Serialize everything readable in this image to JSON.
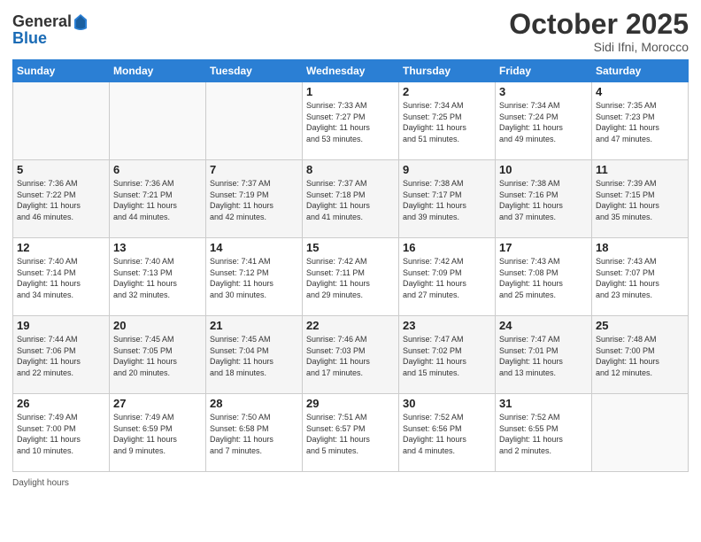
{
  "header": {
    "logo_general": "General",
    "logo_blue": "Blue",
    "month": "October 2025",
    "location": "Sidi Ifni, Morocco"
  },
  "weekdays": [
    "Sunday",
    "Monday",
    "Tuesday",
    "Wednesday",
    "Thursday",
    "Friday",
    "Saturday"
  ],
  "weeks": [
    [
      {
        "day": "",
        "info": ""
      },
      {
        "day": "",
        "info": ""
      },
      {
        "day": "",
        "info": ""
      },
      {
        "day": "1",
        "info": "Sunrise: 7:33 AM\nSunset: 7:27 PM\nDaylight: 11 hours\nand 53 minutes."
      },
      {
        "day": "2",
        "info": "Sunrise: 7:34 AM\nSunset: 7:25 PM\nDaylight: 11 hours\nand 51 minutes."
      },
      {
        "day": "3",
        "info": "Sunrise: 7:34 AM\nSunset: 7:24 PM\nDaylight: 11 hours\nand 49 minutes."
      },
      {
        "day": "4",
        "info": "Sunrise: 7:35 AM\nSunset: 7:23 PM\nDaylight: 11 hours\nand 47 minutes."
      }
    ],
    [
      {
        "day": "5",
        "info": "Sunrise: 7:36 AM\nSunset: 7:22 PM\nDaylight: 11 hours\nand 46 minutes."
      },
      {
        "day": "6",
        "info": "Sunrise: 7:36 AM\nSunset: 7:21 PM\nDaylight: 11 hours\nand 44 minutes."
      },
      {
        "day": "7",
        "info": "Sunrise: 7:37 AM\nSunset: 7:19 PM\nDaylight: 11 hours\nand 42 minutes."
      },
      {
        "day": "8",
        "info": "Sunrise: 7:37 AM\nSunset: 7:18 PM\nDaylight: 11 hours\nand 41 minutes."
      },
      {
        "day": "9",
        "info": "Sunrise: 7:38 AM\nSunset: 7:17 PM\nDaylight: 11 hours\nand 39 minutes."
      },
      {
        "day": "10",
        "info": "Sunrise: 7:38 AM\nSunset: 7:16 PM\nDaylight: 11 hours\nand 37 minutes."
      },
      {
        "day": "11",
        "info": "Sunrise: 7:39 AM\nSunset: 7:15 PM\nDaylight: 11 hours\nand 35 minutes."
      }
    ],
    [
      {
        "day": "12",
        "info": "Sunrise: 7:40 AM\nSunset: 7:14 PM\nDaylight: 11 hours\nand 34 minutes."
      },
      {
        "day": "13",
        "info": "Sunrise: 7:40 AM\nSunset: 7:13 PM\nDaylight: 11 hours\nand 32 minutes."
      },
      {
        "day": "14",
        "info": "Sunrise: 7:41 AM\nSunset: 7:12 PM\nDaylight: 11 hours\nand 30 minutes."
      },
      {
        "day": "15",
        "info": "Sunrise: 7:42 AM\nSunset: 7:11 PM\nDaylight: 11 hours\nand 29 minutes."
      },
      {
        "day": "16",
        "info": "Sunrise: 7:42 AM\nSunset: 7:09 PM\nDaylight: 11 hours\nand 27 minutes."
      },
      {
        "day": "17",
        "info": "Sunrise: 7:43 AM\nSunset: 7:08 PM\nDaylight: 11 hours\nand 25 minutes."
      },
      {
        "day": "18",
        "info": "Sunrise: 7:43 AM\nSunset: 7:07 PM\nDaylight: 11 hours\nand 23 minutes."
      }
    ],
    [
      {
        "day": "19",
        "info": "Sunrise: 7:44 AM\nSunset: 7:06 PM\nDaylight: 11 hours\nand 22 minutes."
      },
      {
        "day": "20",
        "info": "Sunrise: 7:45 AM\nSunset: 7:05 PM\nDaylight: 11 hours\nand 20 minutes."
      },
      {
        "day": "21",
        "info": "Sunrise: 7:45 AM\nSunset: 7:04 PM\nDaylight: 11 hours\nand 18 minutes."
      },
      {
        "day": "22",
        "info": "Sunrise: 7:46 AM\nSunset: 7:03 PM\nDaylight: 11 hours\nand 17 minutes."
      },
      {
        "day": "23",
        "info": "Sunrise: 7:47 AM\nSunset: 7:02 PM\nDaylight: 11 hours\nand 15 minutes."
      },
      {
        "day": "24",
        "info": "Sunrise: 7:47 AM\nSunset: 7:01 PM\nDaylight: 11 hours\nand 13 minutes."
      },
      {
        "day": "25",
        "info": "Sunrise: 7:48 AM\nSunset: 7:00 PM\nDaylight: 11 hours\nand 12 minutes."
      }
    ],
    [
      {
        "day": "26",
        "info": "Sunrise: 7:49 AM\nSunset: 7:00 PM\nDaylight: 11 hours\nand 10 minutes."
      },
      {
        "day": "27",
        "info": "Sunrise: 7:49 AM\nSunset: 6:59 PM\nDaylight: 11 hours\nand 9 minutes."
      },
      {
        "day": "28",
        "info": "Sunrise: 7:50 AM\nSunset: 6:58 PM\nDaylight: 11 hours\nand 7 minutes."
      },
      {
        "day": "29",
        "info": "Sunrise: 7:51 AM\nSunset: 6:57 PM\nDaylight: 11 hours\nand 5 minutes."
      },
      {
        "day": "30",
        "info": "Sunrise: 7:52 AM\nSunset: 6:56 PM\nDaylight: 11 hours\nand 4 minutes."
      },
      {
        "day": "31",
        "info": "Sunrise: 7:52 AM\nSunset: 6:55 PM\nDaylight: 11 hours\nand 2 minutes."
      },
      {
        "day": "",
        "info": ""
      }
    ]
  ],
  "footer": {
    "daylight_label": "Daylight hours"
  }
}
